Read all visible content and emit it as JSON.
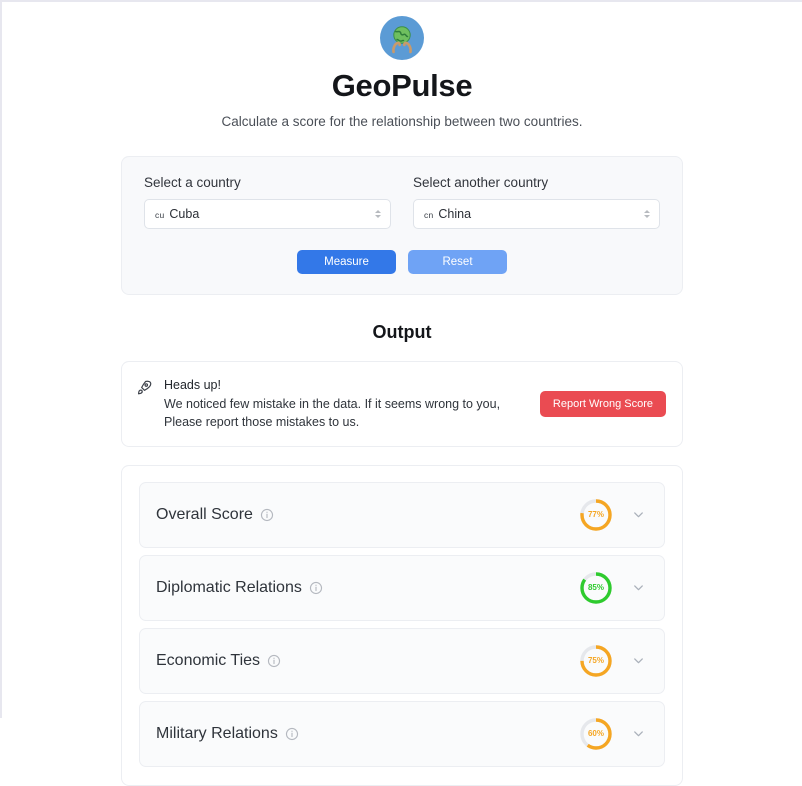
{
  "header": {
    "logo_icon": "globe-in-hands-icon",
    "title": "GeoPulse",
    "subtitle": "Calculate a score for the relationship between two countries."
  },
  "form": {
    "country_a": {
      "label": "Select a country",
      "flag_code": "cu",
      "value": "Cuba"
    },
    "country_b": {
      "label": "Select another country",
      "flag_code": "cn",
      "value": "China"
    },
    "measure_label": "Measure",
    "reset_label": "Reset"
  },
  "output": {
    "title": "Output",
    "alert": {
      "icon": "rocket-icon",
      "heading": "Heads up!",
      "line1": "We noticed few mistake in the data. If it seems wrong to you,",
      "line2": "Please report those mistakes to us.",
      "button_label": "Report Wrong Score"
    },
    "scores": [
      {
        "label": "Overall Score",
        "value": 77,
        "display": "77%",
        "color": "#f5a623"
      },
      {
        "label": "Diplomatic Relations",
        "value": 85,
        "display": "85%",
        "color": "#2ecb2e"
      },
      {
        "label": "Economic Ties",
        "value": 75,
        "display": "75%",
        "color": "#f5a623"
      },
      {
        "label": "Military Relations",
        "value": 60,
        "display": "60%",
        "color": "#f5a623"
      }
    ]
  },
  "colors": {
    "primary": "#3378e8",
    "primary_light": "#6fa3f5",
    "danger": "#ea4b52",
    "track": "#e6e8ec"
  }
}
